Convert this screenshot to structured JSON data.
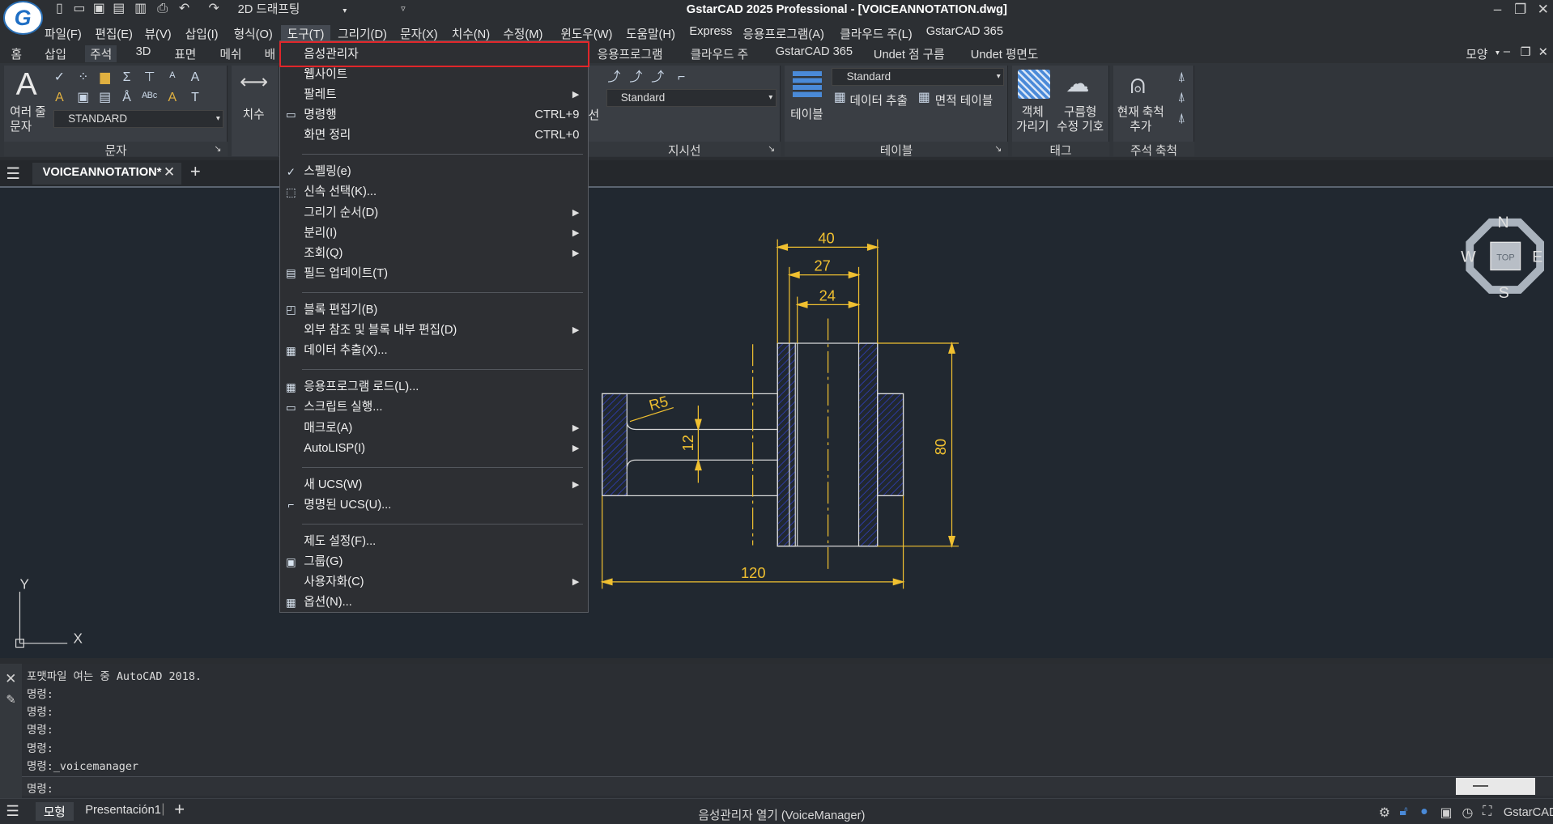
{
  "app": {
    "title": "GstarCAD 2025 Professional - [VOICEANNOTATION.dwg]",
    "workspace": "2D 드래프팅",
    "logo_letter": "G"
  },
  "menubar": [
    "파일(F)",
    "편집(E)",
    "뷰(V)",
    "삽입(I)",
    "형식(O)",
    "도구(T)",
    "그리기(D)",
    "문자(X)",
    "치수(N)",
    "수정(M)",
    "윈도우(W)",
    "도움말(H)",
    "Express",
    "응용프로그램(A)",
    "클라우드 주(L)",
    "GstarCAD 365"
  ],
  "ribbon_tabs": [
    "홈",
    "삽입",
    "주석",
    "3D",
    "표면",
    "메쉬",
    "배",
    "응용프로그램",
    "클라우드 주",
    "GstarCAD 365",
    "Undet 점 구름",
    "Undet 평면도"
  ],
  "ribbon_right": "모양",
  "ribbon": {
    "text_panel": {
      "title": "문자",
      "big_label": "여러 줄\n문자",
      "style": "STANDARD"
    },
    "dim_panel": {
      "label": "치수"
    },
    "leader_panel": {
      "title": "지시선",
      "style": "Standard",
      "side_fragment": "선"
    },
    "table_panel": {
      "title": "테이블",
      "style": "Standard",
      "table_label": "테이블",
      "extract": "데이터 추출",
      "area_table": "면적 테이블"
    },
    "tag_panel": {
      "title": "태그",
      "hide_obj": "객체\n가리기",
      "cloud": "구름형\n수정 기호"
    },
    "scale_panel": {
      "title": "주석 축척",
      "current": "현재 축척\n추가"
    }
  },
  "document_tab": "VOICEANNOTATION*",
  "viewcube": {
    "n": "N",
    "s": "S",
    "e": "E",
    "w": "W",
    "top": "TOP"
  },
  "ucs": {
    "x": "X",
    "y": "Y"
  },
  "drawing": {
    "dims": [
      "40",
      "27",
      "24",
      "R5",
      "12",
      "80",
      "120"
    ]
  },
  "dropdown": [
    {
      "label": "음성관리자",
      "icon": "",
      "short": "",
      "submenu": false,
      "highlight": true
    },
    {
      "label": "웹사이트",
      "icon": "",
      "short": "",
      "submenu": false
    },
    {
      "label": "팔레트",
      "icon": "",
      "short": "",
      "submenu": true
    },
    {
      "label": "명령행",
      "icon": "cmd-icon",
      "short": "CTRL+9",
      "submenu": false
    },
    {
      "label": "화면 정리",
      "icon": "",
      "short": "CTRL+0",
      "submenu": false
    },
    {
      "sep": true
    },
    {
      "label": "스펠링(e)",
      "icon": "spell-icon",
      "short": "",
      "submenu": false
    },
    {
      "label": "신속 선택(K)...",
      "icon": "quickselect-icon",
      "short": "",
      "submenu": false
    },
    {
      "label": "그리기 순서(D)",
      "icon": "",
      "short": "",
      "submenu": true
    },
    {
      "label": "분리(I)",
      "icon": "",
      "short": "",
      "submenu": true
    },
    {
      "label": "조회(Q)",
      "icon": "",
      "short": "",
      "submenu": true
    },
    {
      "label": "필드 업데이트(T)",
      "icon": "field-icon",
      "short": "",
      "submenu": false
    },
    {
      "sep": true
    },
    {
      "label": "블록 편집기(B)",
      "icon": "block-editor-icon",
      "short": "",
      "submenu": false
    },
    {
      "label": "외부 참조 및 블록 내부 편집(D)",
      "icon": "",
      "short": "",
      "submenu": true
    },
    {
      "label": "데이터 추출(X)...",
      "icon": "extract-icon",
      "short": "",
      "submenu": false
    },
    {
      "sep": true
    },
    {
      "label": "응용프로그램 로드(L)...",
      "icon": "appload-icon",
      "short": "",
      "submenu": false
    },
    {
      "label": "스크립트 실행...",
      "icon": "script-icon",
      "short": "",
      "submenu": false
    },
    {
      "label": "매크로(A)",
      "icon": "",
      "short": "",
      "submenu": true
    },
    {
      "label": "AutoLISP(I)",
      "icon": "",
      "short": "",
      "submenu": true
    },
    {
      "sep": true
    },
    {
      "label": "새 UCS(W)",
      "icon": "",
      "short": "",
      "submenu": true
    },
    {
      "label": "명명된 UCS(U)...",
      "icon": "ucs-icon",
      "short": "",
      "submenu": false
    },
    {
      "sep": true
    },
    {
      "label": "제도 설정(F)...",
      "icon": "",
      "short": "",
      "submenu": false
    },
    {
      "label": "그룹(G)",
      "icon": "group-icon",
      "short": "",
      "submenu": false
    },
    {
      "label": "사용자화(C)",
      "icon": "",
      "short": "",
      "submenu": true
    },
    {
      "label": "옵션(N)...",
      "icon": "options-icon",
      "short": "",
      "submenu": false
    }
  ],
  "command_history": [
    "포맷파일 여는 중 AutoCAD 2018.",
    "명령:",
    "명령:",
    "명령:",
    "명령:",
    "명령:_voicemanager"
  ],
  "command_prompt": "명령:",
  "status": {
    "model_tab": "모형",
    "layout_tab": "Presentación1",
    "message": "음성관리자 열기 (VoiceManager)",
    "brand": "GstarCAD"
  }
}
